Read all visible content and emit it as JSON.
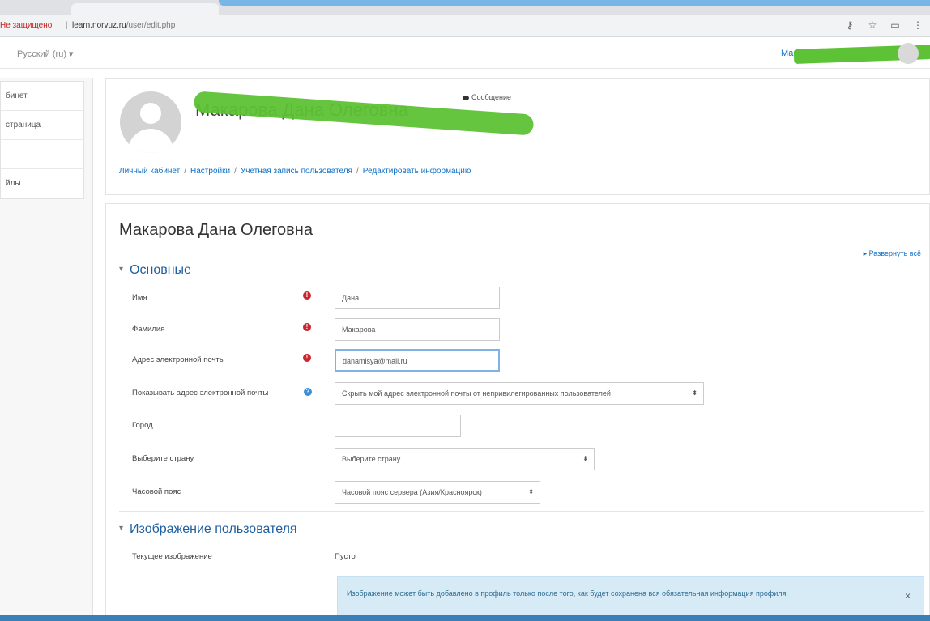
{
  "browser": {
    "security_label": "Не защищено",
    "separator": "|",
    "url_domain": "learn.norvuz.ru",
    "url_path": "/user/edit.php",
    "icons": [
      "key-icon",
      "star-icon",
      "extension-icon",
      "menu-icon"
    ]
  },
  "topnav": {
    "language": "Русский (ru) ▾",
    "user_stub": "Ма"
  },
  "drawer": {
    "items": [
      {
        "label": "бинет"
      },
      {
        "label": "страница"
      },
      {
        "label": ""
      },
      {
        "label": "йлы"
      }
    ]
  },
  "header": {
    "name": "Макарова Дана Олеговна",
    "message_link": "Сообщение",
    "breadcrumb": [
      "Личный кабинет",
      "Настройки",
      "Учетная запись пользователя",
      "Редактировать информацию"
    ]
  },
  "form": {
    "page_title": "Макарова Дана Олеговна",
    "expand_all": "▸ Развернуть всё",
    "sections": {
      "general": "Основные",
      "picture": "Изображение пользователя"
    },
    "fields": {
      "firstname": {
        "label": "Имя",
        "value": "Дана"
      },
      "lastname": {
        "label": "Фамилия",
        "value": "Макарова"
      },
      "email": {
        "label": "Адрес электронной почты",
        "value": "danamisya@mail.ru"
      },
      "maildisplay": {
        "label": "Показывать адрес электронной почты",
        "value": "Скрыть мой адрес электронной почты от непривилегированных пользователей"
      },
      "city": {
        "label": "Город",
        "value": ""
      },
      "country": {
        "label": "Выберите страну",
        "value": "Выберите страну..."
      },
      "timezone": {
        "label": "Часовой пояс",
        "value": "Часовой пояс сервера (Азия/Красноярск)"
      },
      "current_picture": {
        "label": "Текущее изображение",
        "value": "Пусто"
      }
    },
    "alert": {
      "text": "Изображение может быть добавлено в профиль только после того, как будет сохранена вся обязательная информация профиля.",
      "close": "×"
    }
  },
  "colors": {
    "link": "#0f6fc5",
    "section": "#1f5fa0",
    "required": "#c9262f",
    "help": "#3a8ed8",
    "alert_bg": "#d7ebf7",
    "redaction": "#5dc235"
  }
}
